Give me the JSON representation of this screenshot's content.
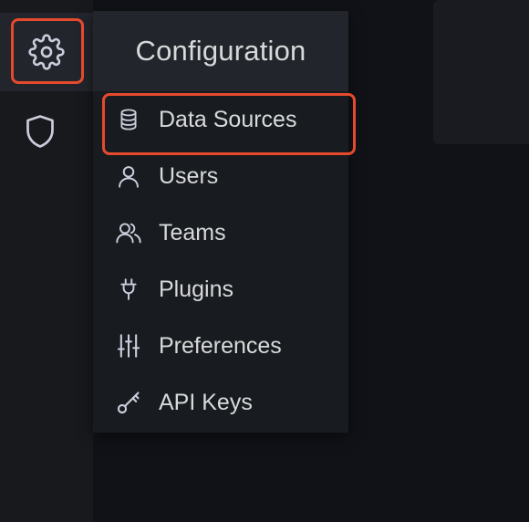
{
  "rail": {
    "items": [
      {
        "icon": "gear-icon",
        "name": "configuration"
      },
      {
        "icon": "shield-icon",
        "name": "server-admin"
      }
    ]
  },
  "menu": {
    "title": "Configuration",
    "items": [
      {
        "label": "Data Sources",
        "icon": "database-icon"
      },
      {
        "label": "Users",
        "icon": "user-icon"
      },
      {
        "label": "Teams",
        "icon": "users-icon"
      },
      {
        "label": "Plugins",
        "icon": "plug-icon"
      },
      {
        "label": "Preferences",
        "icon": "sliders-icon"
      },
      {
        "label": "API Keys",
        "icon": "key-icon"
      }
    ]
  },
  "colors": {
    "highlight": "#e64a2e",
    "text": "#d8d9da",
    "icon": "#ccccdc",
    "rail_bg": "#18191d",
    "menu_bg": "#181b1f",
    "header_bg": "#22252b"
  }
}
